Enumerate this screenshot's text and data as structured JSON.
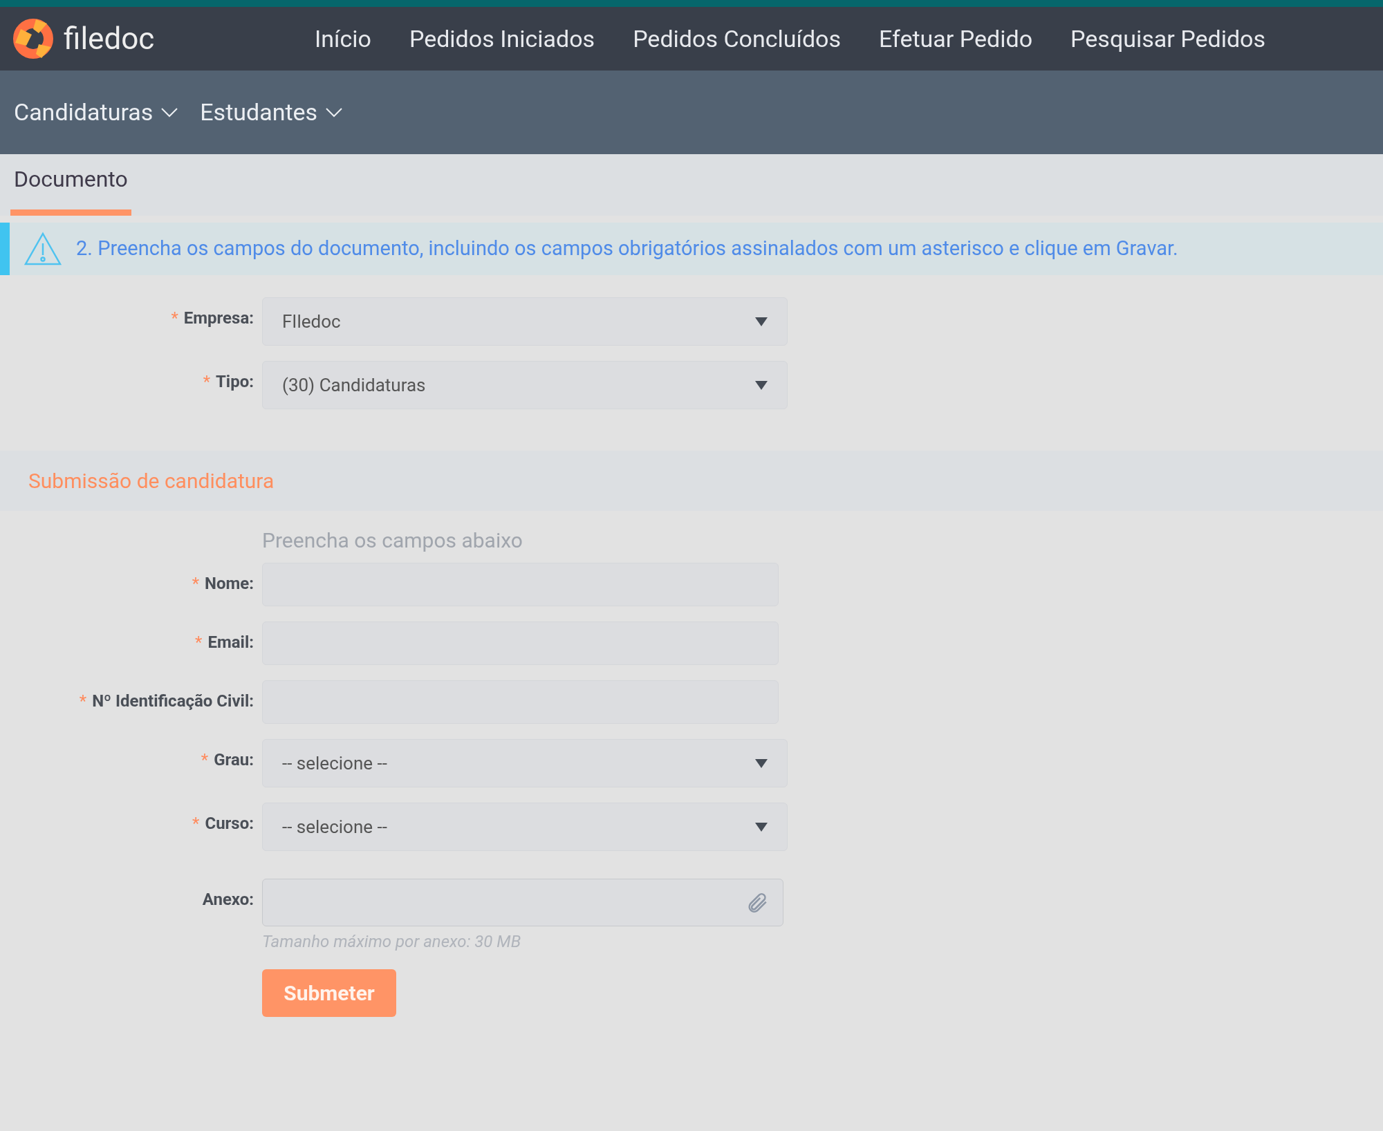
{
  "header": {
    "logo_text": "filedoc",
    "nav": [
      {
        "label": "Início"
      },
      {
        "label": "Pedidos Iniciados"
      },
      {
        "label": "Pedidos Concluídos"
      },
      {
        "label": "Efetuar Pedido"
      },
      {
        "label": "Pesquisar Pedidos"
      }
    ]
  },
  "subnav": [
    {
      "label": "Candidaturas"
    },
    {
      "label": "Estudantes"
    }
  ],
  "tabs": [
    {
      "label": "Documento",
      "selected": true
    }
  ],
  "alert": {
    "text": "2. Preencha os campos do documento, incluindo os campos obrigatórios assinalados com um asterisco e clique em Gravar."
  },
  "top_fields": [
    {
      "kind": "select",
      "label": "Empresa:",
      "required_mark": "*",
      "value": "FIledoc"
    },
    {
      "kind": "select",
      "label": "Tipo:",
      "required_mark": "*",
      "value": "(30) Candidaturas"
    }
  ],
  "section": {
    "title": "Submissão de candidatura",
    "intro": "Preencha os campos abaixo",
    "fields": [
      {
        "kind": "text",
        "label": "Nome:",
        "required_mark": "*"
      },
      {
        "kind": "text",
        "label": "Email:",
        "required_mark": "*"
      },
      {
        "kind": "text",
        "label": "Nº Identificação Civil:",
        "required_mark": "*"
      },
      {
        "kind": "select",
        "label": "Grau:",
        "required_mark": "*",
        "value": "-- selecione --"
      },
      {
        "kind": "select",
        "label": "Curso:",
        "required_mark": "*",
        "value": "-- selecione --"
      },
      {
        "kind": "file",
        "label": "Anexo:",
        "hint": "Tamanho máximo por anexo: 30 MB"
      }
    ],
    "submit": "Submeter"
  }
}
